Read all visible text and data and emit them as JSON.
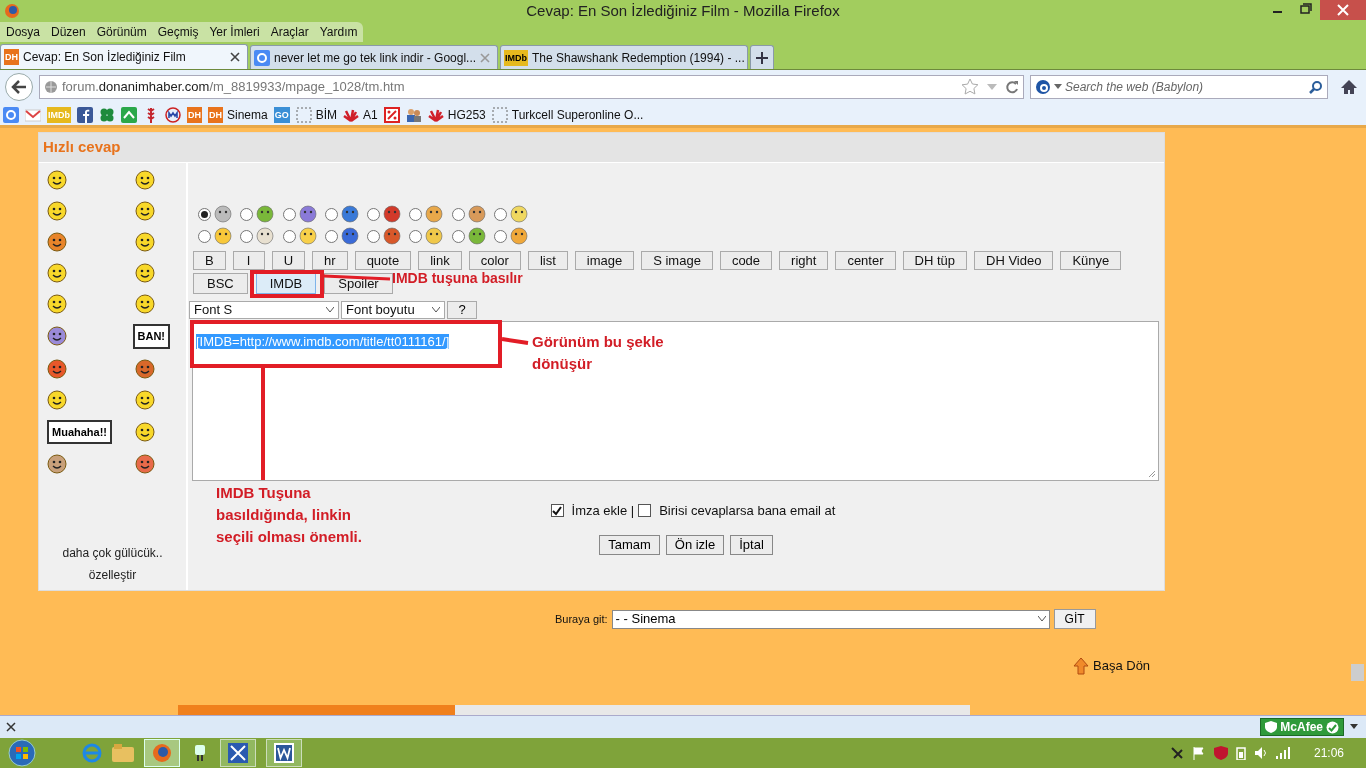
{
  "window": {
    "title": "Cevap: En Son İzlediğiniz Film - Mozilla Firefox"
  },
  "menu": [
    "Dosya",
    "Düzen",
    "Görünüm",
    "Geçmiş",
    "Yer İmleri",
    "Araçlar",
    "Yardım"
  ],
  "tabs": [
    {
      "label": "Cevap: En Son İzlediğiniz Film",
      "badge": "DH",
      "kind": "dh",
      "selected": true
    },
    {
      "label": "never let me go tek link indir - Googl...",
      "kind": "google",
      "selected": false
    },
    {
      "label": "The Shawshank Redemption (1994) - ...",
      "badge": "IMDb",
      "kind": "imdb",
      "selected": false
    }
  ],
  "address": {
    "prefix": "forum.",
    "domain": "donanimhaber.com",
    "path": "/m_8819933/mpage_1028/tm.htm"
  },
  "search": {
    "placeholder": "Search the web (Babylon)"
  },
  "bookmarks": [
    {
      "kind": "google"
    },
    {
      "kind": "gmail"
    },
    {
      "kind": "badge",
      "badge": "IMDb",
      "color": "#e6b91e"
    },
    {
      "kind": "facebook"
    },
    {
      "kind": "clover"
    },
    {
      "kind": "green"
    },
    {
      "kind": "wheat"
    },
    {
      "kind": "m"
    },
    {
      "kind": "badge",
      "badge": "DH",
      "color": "#e8731c"
    },
    {
      "kind": "badge",
      "badge": "DH",
      "color": "#e8731c",
      "label": "Sinema"
    },
    {
      "kind": "badge",
      "badge": "GO",
      "color": "#3a8fd6"
    },
    {
      "kind": "dashed",
      "label": "BİM"
    },
    {
      "kind": "huawei",
      "label": "A1"
    },
    {
      "kind": "percent"
    },
    {
      "kind": "people"
    },
    {
      "kind": "huawei",
      "label": "HG253"
    },
    {
      "kind": "dashed",
      "label": "Turkcell Superonline O..."
    }
  ],
  "reply": {
    "title": "Hızlı cevap",
    "emoticons": [
      {
        "kind": "face"
      },
      {
        "kind": "face"
      },
      {
        "kind": "face"
      },
      {
        "kind": "face"
      },
      {
        "kind": "face"
      },
      {
        "kind": "face"
      },
      {
        "kind": "face"
      },
      {
        "kind": "face"
      },
      {
        "kind": "face"
      },
      {
        "kind": "face"
      },
      {
        "kind": "face"
      },
      {
        "kind": "sign",
        "label": "BAN!"
      },
      {
        "kind": "face"
      },
      {
        "kind": "face"
      },
      {
        "kind": "face"
      },
      {
        "kind": "face"
      },
      {
        "kind": "sign",
        "label": "Muahaha!!"
      },
      {
        "kind": "face"
      },
      {
        "kind": "face"
      },
      {
        "kind": "face"
      }
    ],
    "more_link": "daha çok gülücük..",
    "customize_link": "özelleştir",
    "post_icons": [
      {
        "selected": true
      },
      {
        "selected": false
      },
      {
        "selected": false
      },
      {
        "selected": false
      },
      {
        "selected": false
      },
      {
        "selected": false
      },
      {
        "selected": false
      },
      {
        "selected": false
      },
      {
        "selected": false
      },
      {
        "selected": false
      },
      {
        "selected": false
      },
      {
        "selected": false
      },
      {
        "selected": false
      },
      {
        "selected": false
      },
      {
        "selected": false
      },
      {
        "selected": false
      }
    ],
    "buttons_row_1": [
      "B",
      "I",
      "U",
      "hr",
      "quote",
      "link",
      "color",
      "list",
      "image",
      "S image",
      "code",
      "right",
      "center",
      "DH tüp",
      "DH Video",
      "Künye"
    ],
    "buttons_row_2": [
      {
        "label": "BSC",
        "selected": false
      },
      {
        "label": "IMDB",
        "selected": true
      },
      {
        "label": "Spoiler",
        "selected": false
      }
    ],
    "font_select": "Font S",
    "size_select": "Font boyutu",
    "help_button": "?",
    "message": "[IMDB=http://www.imdb.com/title/tt0111161/]",
    "options": [
      {
        "label": "İmza ekle |",
        "checked": true
      },
      {
        "label": "Birisi cevaplarsa bana email at",
        "checked": false
      }
    ],
    "actions": [
      "Tamam",
      "Ön izle",
      "İptal"
    ]
  },
  "jump": {
    "label": "Buraya git:",
    "value": "- - Sinema",
    "button": "GİT"
  },
  "back_to_top": "Başa Dön",
  "annotations": [
    "IMDB tuşuna basılır",
    "Görünüm bu şekle dönüşür",
    "IMDB Tuşuna basıldığında, linkin seçili olması önemli."
  ],
  "addon_bar": {
    "badge": "McAfee"
  },
  "taskbar": {
    "clock": "21:06"
  }
}
